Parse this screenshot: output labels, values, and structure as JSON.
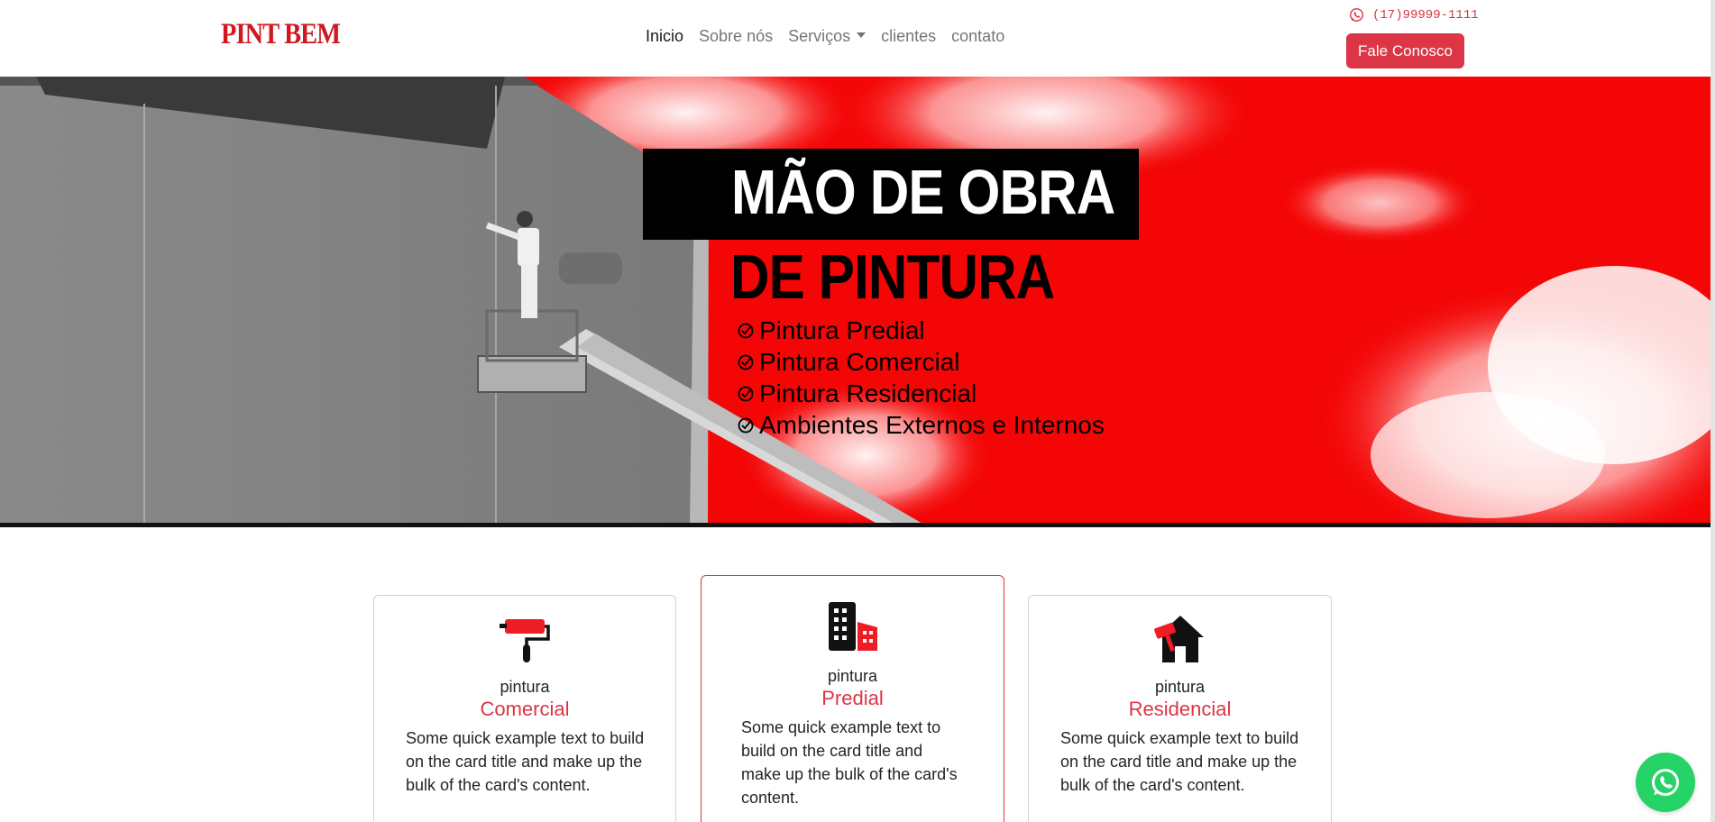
{
  "nav": {
    "brand": "PINT BEM",
    "links": [
      "Inicio",
      "Sobre nós",
      "Serviços",
      "clientes",
      "contato"
    ],
    "phone": "(17)99999-1111",
    "cta": "Fale Conosco"
  },
  "hero": {
    "title_line1": "MÃO DE OBRA",
    "title_line2": "DE PINTURA",
    "items": [
      "Pintura Predial",
      "Pintura Comercial",
      "Pintura Residencial",
      "Ambientes Externos e Internos"
    ]
  },
  "cards": [
    {
      "icon": "paint-roller-icon",
      "kicker": "pintura",
      "title": "Comercial",
      "text": "Some quick example text to build on the card title and make up the bulk of the card's content."
    },
    {
      "icon": "building-icon",
      "kicker": "pintura",
      "title": "Predial",
      "text": "Some quick example text to build on the card title and make up the bulk of the card's content."
    },
    {
      "icon": "house-icon",
      "kicker": "pintura",
      "title": "Residencial",
      "text": "Some quick example text to build on the card title and make up the bulk of the card's content."
    }
  ],
  "colors": {
    "accent": "#dc3545",
    "hero_red": "#f40606",
    "whatsapp": "#25d366"
  }
}
